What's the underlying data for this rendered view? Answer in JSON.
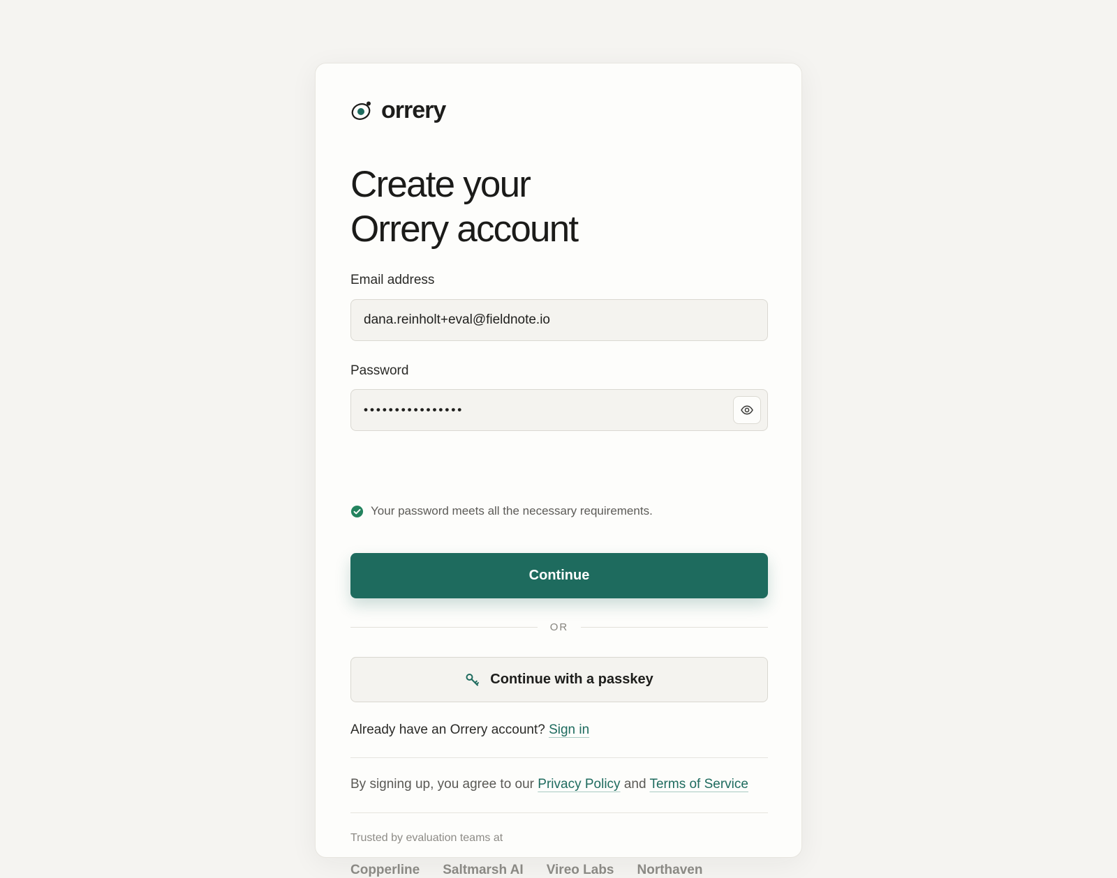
{
  "brand": {
    "name": "orrery",
    "logo_icon": "orbit-logo-icon",
    "accent_color": "#1e6b5e"
  },
  "heading": {
    "line1": "Create your",
    "line2": "Orrery account"
  },
  "email": {
    "label": "Email address",
    "value": "dana.reinholt+eval@fieldnote.io"
  },
  "password": {
    "label": "Password",
    "value_masked": "••••••••••••••••",
    "toggle_icon": "eye-icon",
    "hint_icon": "check-circle-icon",
    "hint": "Your password meets all the necessary requirements."
  },
  "actions": {
    "continue_label": "Continue",
    "divider_label": "OR",
    "passkey_label": "Continue with a passkey",
    "passkey_icon": "key-icon"
  },
  "signin": {
    "prompt": "Already have an Orrery account?",
    "link": "Sign in"
  },
  "terms": {
    "prefix": "By signing up, you agree to our",
    "privacy_link": "Privacy Policy",
    "conjunction": "and",
    "tos_link": "Terms of Service"
  },
  "trusted": {
    "label": "Trusted by evaluation teams at",
    "companies": [
      "Copperline",
      "Saltmarsh AI",
      "Vireo Labs",
      "Northaven"
    ]
  }
}
